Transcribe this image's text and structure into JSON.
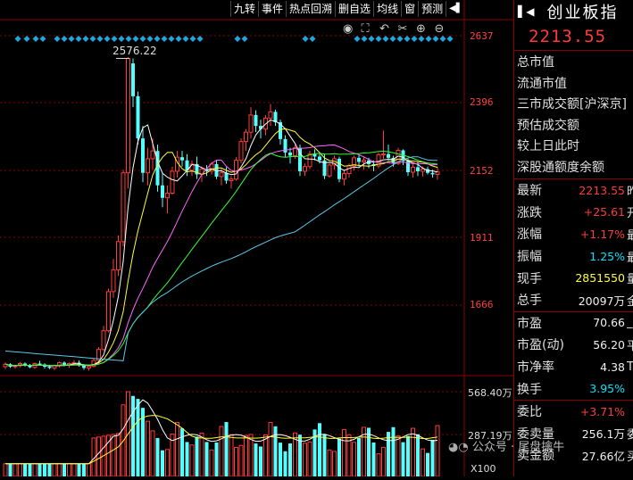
{
  "toolbar": {
    "items": [
      "九转",
      "事件",
      "热点回溯",
      "删自选",
      "均线",
      "窗",
      "预测"
    ],
    "collapse_icon": "collapse-right-icon"
  },
  "chart_tools": [
    "eye-icon",
    "fullscreen-icon",
    "undo-icon",
    "scissors-icon",
    "zoom-in-icon",
    "zoom-out-icon"
  ],
  "price_axis": [
    "2637",
    "2396",
    "2152",
    "1911",
    "1666"
  ],
  "volume_axis": [
    "568.40万",
    "287.19万",
    "X100"
  ],
  "annotation": "2576.22",
  "watermark": "公众号 · 尾盘擒牛",
  "panel": {
    "title": "创业板指",
    "price": "2213.55",
    "info_labels": [
      "总市值",
      "流通市值",
      "三市成交额[沪深京]",
      "预估成交额",
      "较上日此时",
      "深股通额度余额"
    ],
    "quotes": [
      {
        "label": "最新",
        "value": "2213.55",
        "unit": "昨",
        "color": "red"
      },
      {
        "label": "涨跌",
        "value": "+25.61",
        "unit": "开",
        "color": "red"
      },
      {
        "label": "涨幅",
        "value": "+1.17%",
        "unit": "最",
        "color": "red"
      },
      {
        "label": "振幅",
        "value": "1.25%",
        "unit": "最",
        "color": "cyan"
      },
      {
        "label": "现手",
        "value": "2851550",
        "unit": "量",
        "color": "yellow"
      },
      {
        "label": "总手",
        "value": "20097万",
        "unit": "金",
        "color": "white"
      },
      {
        "label": "市盈",
        "value": "70.66",
        "unit": "_",
        "color": "white"
      },
      {
        "label": "市盈(动)",
        "value": "56.20",
        "unit": "平",
        "color": "white"
      },
      {
        "label": "市净率",
        "value": "4.38",
        "unit": "T",
        "color": "white"
      },
      {
        "label": "换手",
        "value": "3.95%",
        "unit": "",
        "color": "cyan"
      },
      {
        "label": "委比",
        "value": "+3.71%",
        "unit": "",
        "color": "red"
      },
      {
        "label": "委卖量",
        "value": "256.1万",
        "unit": "委",
        "color": "white"
      },
      {
        "label": "卖金额",
        "value": "27.66亿",
        "unit": "买",
        "color": "white"
      }
    ]
  },
  "chart_data": {
    "type": "candlestick",
    "price_range": [
      1570,
      2700
    ],
    "candles": [
      [
        1590,
        1603,
        1582,
        1598
      ],
      [
        1598,
        1601,
        1586,
        1590
      ],
      [
        1590,
        1596,
        1584,
        1593
      ],
      [
        1593,
        1605,
        1588,
        1600
      ],
      [
        1600,
        1604,
        1590,
        1595
      ],
      [
        1595,
        1599,
        1585,
        1588
      ],
      [
        1588,
        1603,
        1583,
        1600
      ],
      [
        1600,
        1609,
        1594,
        1597
      ],
      [
        1597,
        1601,
        1584,
        1590
      ],
      [
        1590,
        1596,
        1582,
        1586
      ],
      [
        1586,
        1596,
        1579,
        1593
      ],
      [
        1593,
        1606,
        1588,
        1603
      ],
      [
        1603,
        1607,
        1591,
        1596
      ],
      [
        1596,
        1603,
        1586,
        1600
      ],
      [
        1600,
        1611,
        1595,
        1603
      ],
      [
        1603,
        1610,
        1590,
        1594
      ],
      [
        1594,
        1599,
        1580,
        1586
      ],
      [
        1586,
        1596,
        1578,
        1591
      ],
      [
        1591,
        1616,
        1588,
        1610
      ],
      [
        1610,
        1652,
        1605,
        1645
      ],
      [
        1645,
        1720,
        1640,
        1705
      ],
      [
        1705,
        1840,
        1700,
        1830
      ],
      [
        1830,
        1935,
        1810,
        1900
      ],
      [
        1900,
        2010,
        1880,
        1990
      ],
      [
        1990,
        2220,
        1975,
        2210
      ],
      [
        2210,
        2580,
        2160,
        2576
      ],
      [
        2560,
        2576,
        2420,
        2455
      ],
      [
        2455,
        2470,
        2300,
        2320
      ],
      [
        2320,
        2360,
        2180,
        2210
      ],
      [
        2210,
        2290,
        2170,
        2255
      ],
      [
        2255,
        2320,
        2220,
        2280
      ],
      [
        2280,
        2300,
        2150,
        2170
      ],
      [
        2170,
        2210,
        2100,
        2130
      ],
      [
        2130,
        2170,
        2080,
        2145
      ],
      [
        2145,
        2230,
        2140,
        2215
      ],
      [
        2215,
        2280,
        2195,
        2260
      ],
      [
        2260,
        2280,
        2230,
        2250
      ],
      [
        2250,
        2270,
        2200,
        2218
      ],
      [
        2218,
        2250,
        2200,
        2238
      ],
      [
        2238,
        2262,
        2190,
        2205
      ],
      [
        2205,
        2230,
        2180,
        2222
      ],
      [
        2222,
        2235,
        2200,
        2215
      ],
      [
        2215,
        2245,
        2205,
        2238
      ],
      [
        2238,
        2250,
        2190,
        2198
      ],
      [
        2198,
        2225,
        2170,
        2210
      ],
      [
        2210,
        2228,
        2175,
        2185
      ],
      [
        2185,
        2200,
        2160,
        2190
      ],
      [
        2190,
        2260,
        2185,
        2250
      ],
      [
        2250,
        2320,
        2240,
        2310
      ],
      [
        2310,
        2350,
        2280,
        2340
      ],
      [
        2340,
        2420,
        2320,
        2395
      ],
      [
        2395,
        2410,
        2340,
        2360
      ],
      [
        2360,
        2380,
        2320,
        2350
      ],
      [
        2350,
        2395,
        2330,
        2385
      ],
      [
        2385,
        2430,
        2360,
        2405
      ],
      [
        2405,
        2412,
        2360,
        2372
      ],
      [
        2372,
        2380,
        2300,
        2318
      ],
      [
        2318,
        2330,
        2260,
        2275
      ],
      [
        2275,
        2290,
        2240,
        2265
      ],
      [
        2265,
        2300,
        2255,
        2290
      ],
      [
        2290,
        2300,
        2200,
        2215
      ],
      [
        2215,
        2240,
        2200,
        2230
      ],
      [
        2230,
        2280,
        2222,
        2270
      ],
      [
        2270,
        2285,
        2250,
        2262
      ],
      [
        2262,
        2275,
        2240,
        2250
      ],
      [
        2250,
        2270,
        2190,
        2200
      ],
      [
        2200,
        2240,
        2195,
        2235
      ],
      [
        2235,
        2265,
        2220,
        2255
      ],
      [
        2255,
        2262,
        2180,
        2190
      ],
      [
        2190,
        2220,
        2170,
        2208
      ],
      [
        2208,
        2240,
        2195,
        2232
      ],
      [
        2232,
        2265,
        2218,
        2258
      ],
      [
        2258,
        2268,
        2230,
        2245
      ],
      [
        2245,
        2260,
        2220,
        2250
      ],
      [
        2250,
        2258,
        2225,
        2238
      ],
      [
        2238,
        2250,
        2215,
        2232
      ],
      [
        2232,
        2275,
        2225,
        2268
      ],
      [
        2268,
        2345,
        2255,
        2270
      ],
      [
        2270,
        2300,
        2250,
        2258
      ],
      [
        2258,
        2265,
        2230,
        2240
      ],
      [
        2240,
        2290,
        2235,
        2282
      ],
      [
        2282,
        2285,
        2235,
        2248
      ],
      [
        2248,
        2255,
        2200,
        2212
      ],
      [
        2212,
        2240,
        2195,
        2228
      ],
      [
        2228,
        2245,
        2200,
        2215
      ],
      [
        2215,
        2230,
        2198,
        2222
      ],
      [
        2222,
        2230,
        2205,
        2210
      ],
      [
        2210,
        2220,
        2195,
        2205
      ],
      [
        2205,
        2230,
        2188,
        2213
      ]
    ],
    "volume_max": 568.4
  }
}
